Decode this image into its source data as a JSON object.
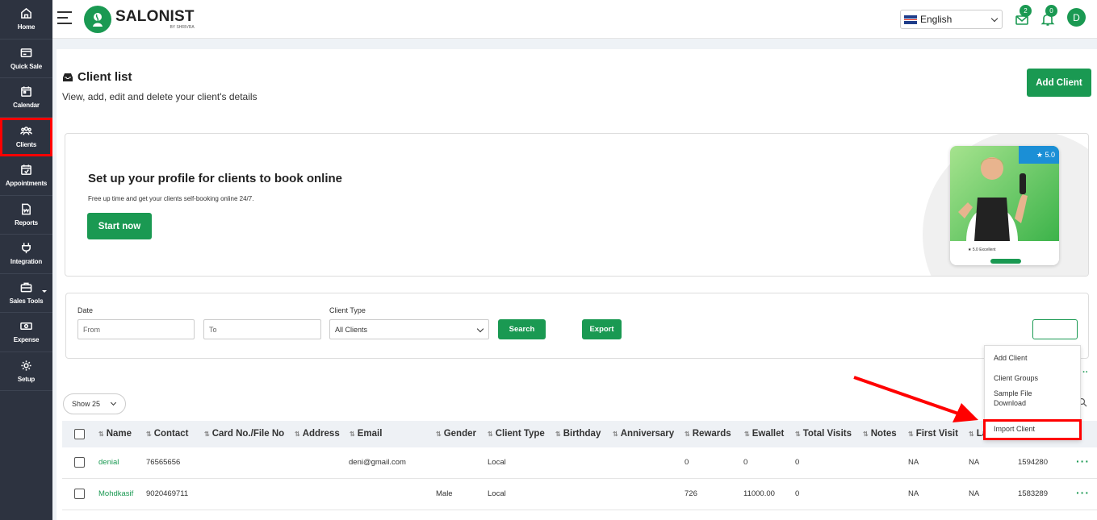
{
  "sidebar": {
    "items": [
      {
        "label": "Home",
        "icon": "home-icon"
      },
      {
        "label": "Quick Sale",
        "icon": "quick-sale-icon"
      },
      {
        "label": "Calendar",
        "icon": "calendar-icon"
      },
      {
        "label": "Clients",
        "icon": "clients-icon"
      },
      {
        "label": "Appointments",
        "icon": "appointments-icon"
      },
      {
        "label": "Reports",
        "icon": "reports-icon"
      },
      {
        "label": "Integration",
        "icon": "integration-icon"
      },
      {
        "label": "Sales Tools",
        "icon": "sales-tools-icon"
      },
      {
        "label": "Expense",
        "icon": "expense-icon"
      },
      {
        "label": "Setup",
        "icon": "setup-icon"
      }
    ]
  },
  "topbar": {
    "logo_main": "SALONIST",
    "logo_sub": "BY SHRIVRA",
    "language": "English",
    "messages_count": "2",
    "notifications_count": "0",
    "avatar_initial": "D"
  },
  "page": {
    "title": "Client list",
    "subtitle": "View, add, edit and delete your client's details",
    "add_client_label": "Add Client"
  },
  "promo": {
    "title": "Set up your profile for clients to book online",
    "subtitle": "Free up time and get your clients self-booking online 24/7.",
    "button_label": "Start now",
    "rating": "★ 5.0",
    "rating_caption": "★ 5.0 Excellent"
  },
  "filter": {
    "date_label": "Date",
    "from_placeholder": "From",
    "to_placeholder": "To",
    "client_type_label": "Client Type",
    "client_type_value": "All Clients",
    "search_label": "Search",
    "export_label": "Export"
  },
  "dropdown_menu": {
    "items": [
      "Add Client",
      "Client Groups",
      "Sample File Download",
      "Import Client"
    ],
    "highlighted": "Import Client"
  },
  "table": {
    "show_label": "Show 25",
    "columns": [
      "Name",
      "Contact",
      "Card No./File No",
      "Address",
      "Email",
      "Gender",
      "Client Type",
      "Birthday",
      "Anniversary",
      "Rewards",
      "Ewallet",
      "Total Visits",
      "Notes",
      "First Visit",
      "La"
    ],
    "rows": [
      {
        "name": "denial",
        "contact": "76565656",
        "card": "",
        "address": "",
        "email": "deni@gmail.com",
        "gender": "",
        "client_type": "Local",
        "birthday": "",
        "anniversary": "",
        "rewards": "0",
        "ewallet": "0",
        "total_visits": "0",
        "notes": "",
        "first_visit": "NA",
        "last_visit": "NA",
        "id": "1594280"
      },
      {
        "name": "Mohdkasif",
        "contact": "9020469711",
        "card": "",
        "address": "",
        "email": "",
        "gender": "Male",
        "client_type": "Local",
        "birthday": "",
        "anniversary": "",
        "rewards": "726",
        "ewallet": "11000.00",
        "total_visits": "0",
        "notes": "",
        "first_visit": "NA",
        "last_visit": "NA",
        "id": "1583289"
      }
    ]
  },
  "colors": {
    "brand_green": "#1a9952",
    "sidebar_bg": "#2d3340",
    "highlight_red": "#ff0000"
  }
}
